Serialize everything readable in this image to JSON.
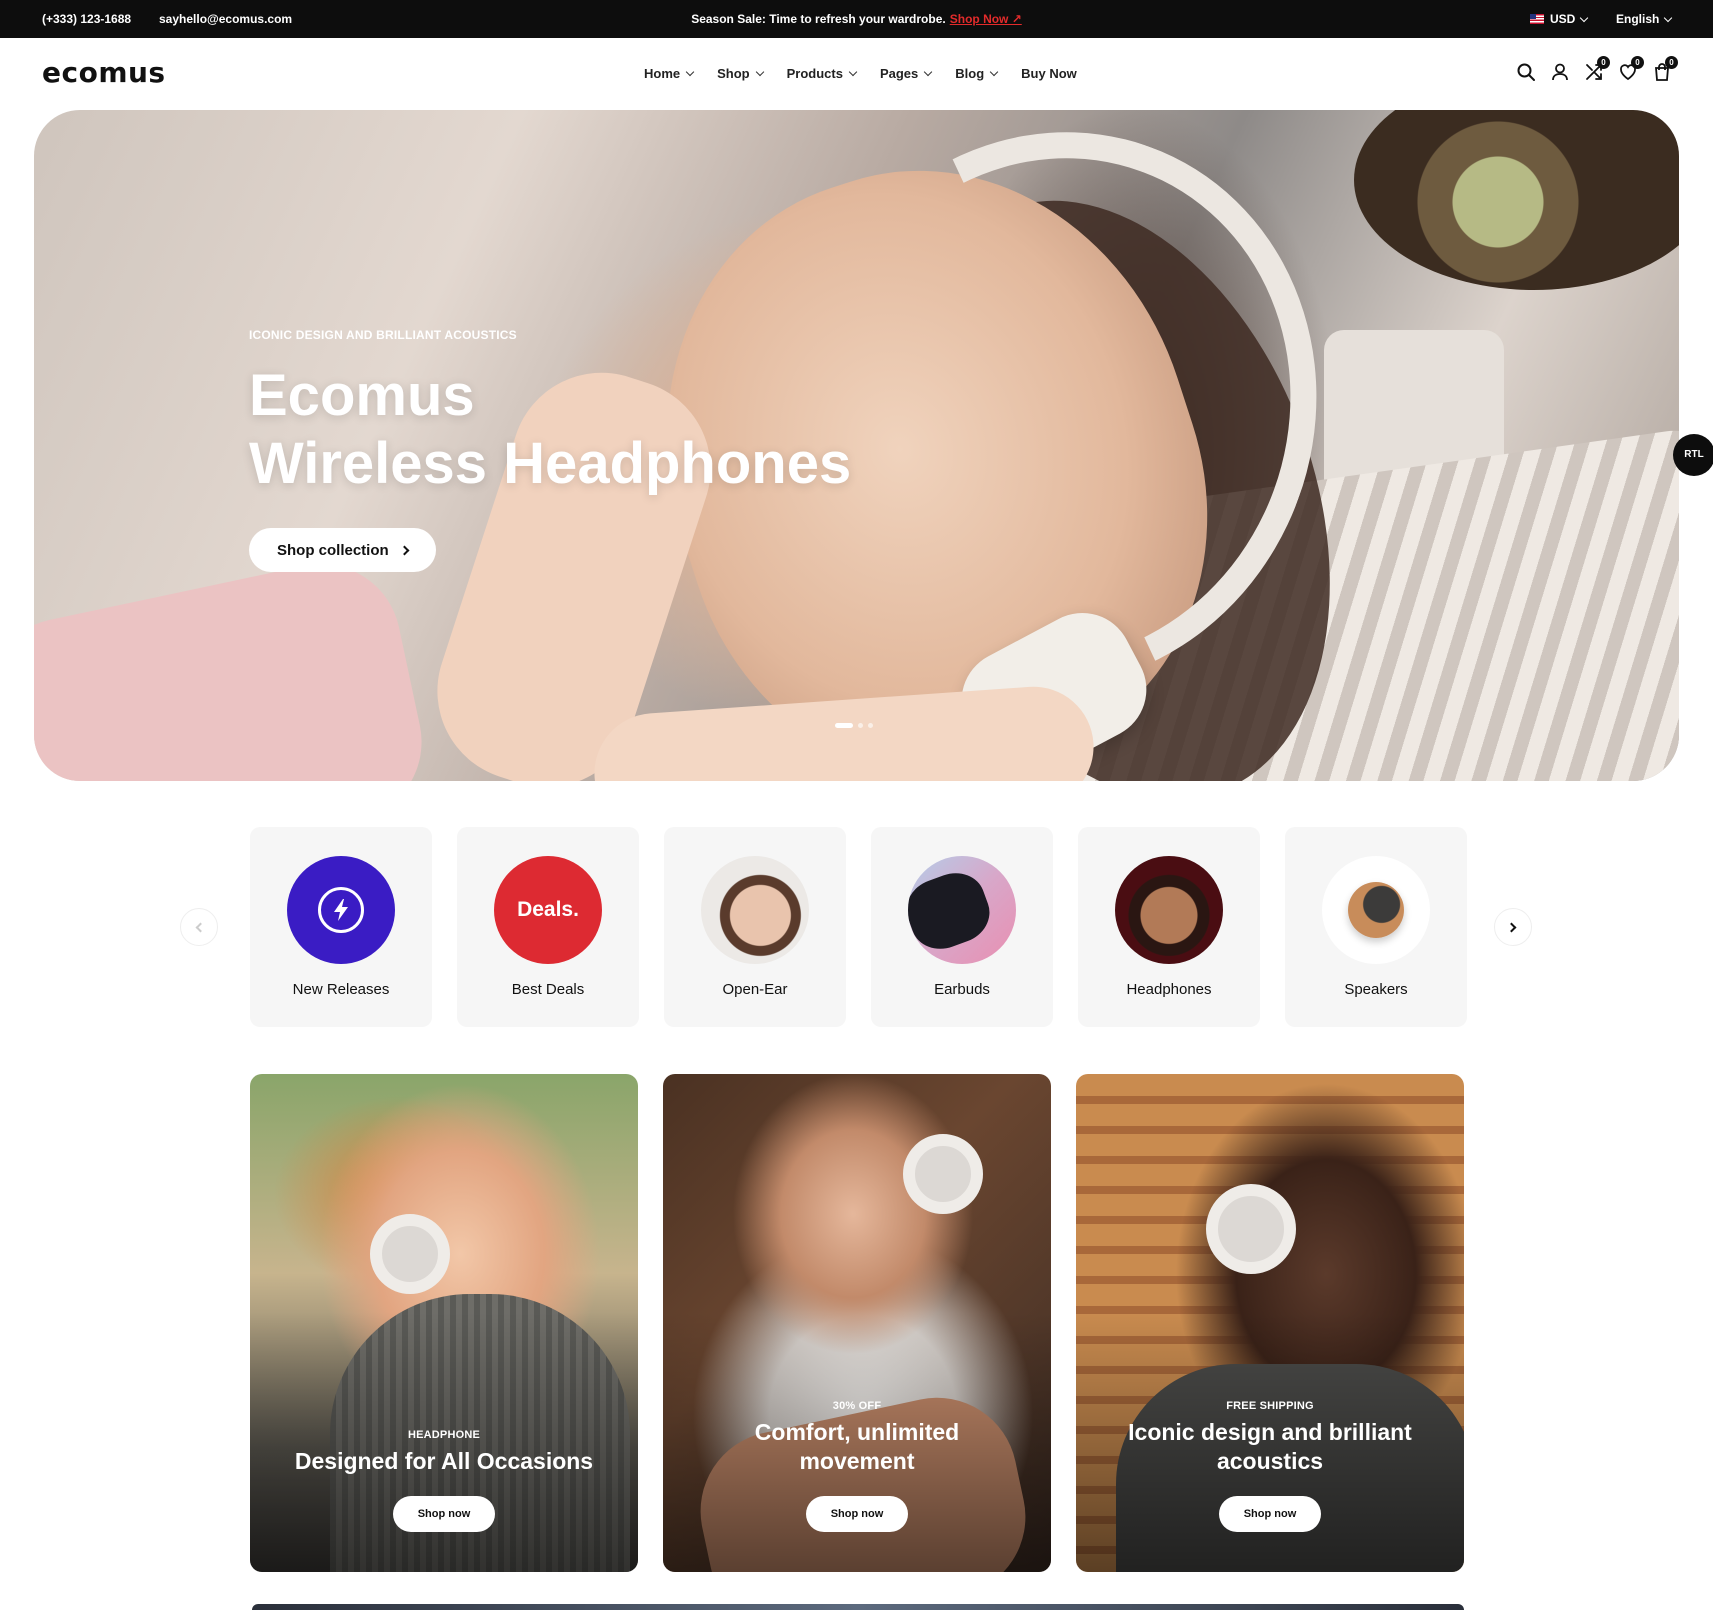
{
  "topbar": {
    "phone": "(+333) 123-1688",
    "email": "sayhello@ecomus.com",
    "promo_text": "Season Sale: Time to refresh your wardrobe.",
    "promo_link": "Shop Now ↗",
    "currency": "USD",
    "language": "English"
  },
  "header": {
    "logo": "ecomus",
    "nav": [
      {
        "label": "Home",
        "has_dropdown": true
      },
      {
        "label": "Shop",
        "has_dropdown": true
      },
      {
        "label": "Products",
        "has_dropdown": true
      },
      {
        "label": "Pages",
        "has_dropdown": true
      },
      {
        "label": "Blog",
        "has_dropdown": true
      },
      {
        "label": "Buy Now",
        "has_dropdown": false
      }
    ],
    "icons": [
      "search-icon",
      "account-icon",
      "compare-icon",
      "wishlist-icon",
      "cart-icon"
    ],
    "badges": {
      "compare": "0",
      "wishlist": "0",
      "cart": "0"
    }
  },
  "hero": {
    "eyebrow": "ICONIC DESIGN AND BRILLIANT ACOUSTICS",
    "title_line1": "Ecomus",
    "title_line2": "Wireless Headphones",
    "cta": "Shop collection",
    "slides": 3,
    "active_slide": 1
  },
  "rtl_label": "RTL",
  "categories": [
    {
      "label": "New Releases",
      "icon": "lightning-icon",
      "color": "#3a1cc4"
    },
    {
      "label": "Best Deals",
      "badge_text": "Deals.",
      "color": "#dd2a32"
    },
    {
      "label": "Open-Ear"
    },
    {
      "label": "Earbuds"
    },
    {
      "label": "Headphones"
    },
    {
      "label": "Speakers"
    }
  ],
  "promos": [
    {
      "eyebrow": "HEADPHONE",
      "heading": "Designed for All Occasions",
      "button": "Shop now"
    },
    {
      "eyebrow": "30% OFF",
      "heading": "Comfort, unlimited movement",
      "button": "Shop now"
    },
    {
      "eyebrow": "FREE SHIPPING",
      "heading": "Iconic design and brilliant acoustics",
      "button": "Shop now"
    }
  ],
  "colors": {
    "dark": "#0d0d0d",
    "accent_red": "#e32b2b",
    "card_bg": "#f6f6f6"
  }
}
